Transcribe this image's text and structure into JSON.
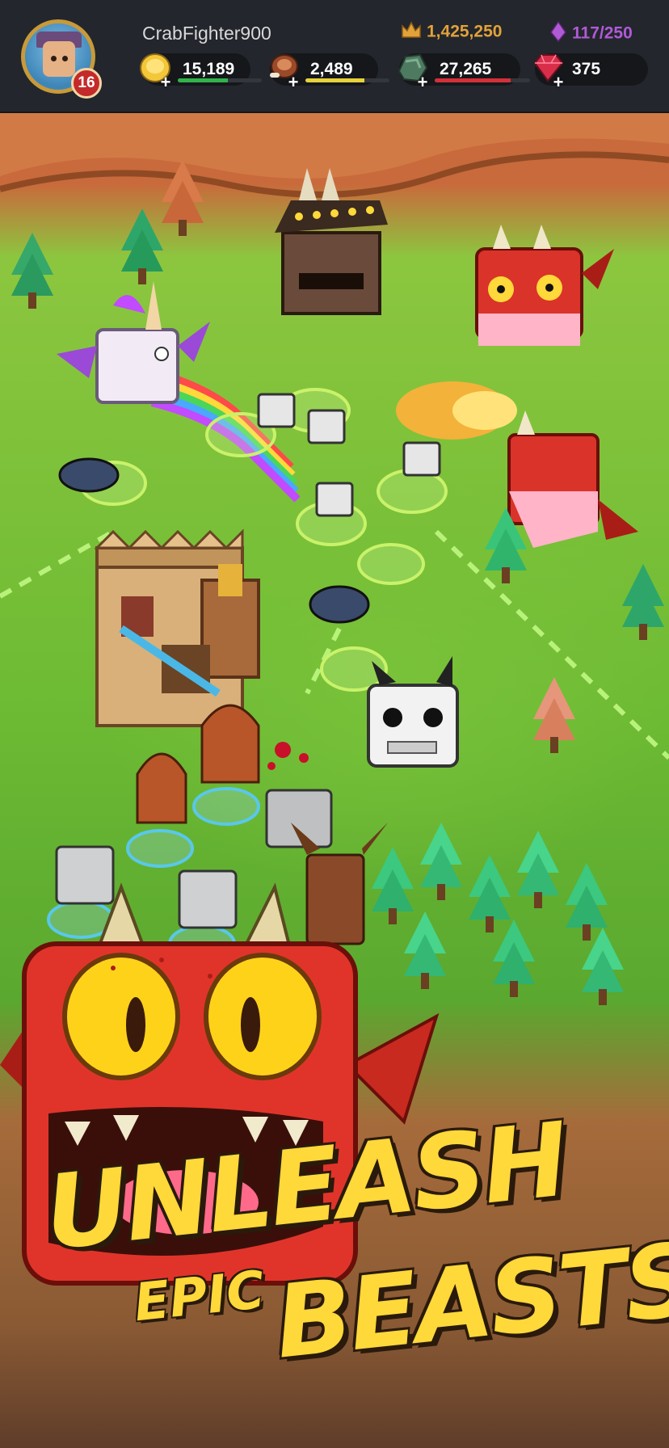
{
  "player": {
    "username": "CrabFighter900",
    "level": "16"
  },
  "hud": {
    "crowns": "1,425,250",
    "gems": "117/250",
    "resources": [
      {
        "name": "gold",
        "icon": "gold-coin-icon",
        "value": "15,189",
        "bar_color": "#2fb34a",
        "fill": 0.6
      },
      {
        "name": "meat",
        "icon": "meat-icon",
        "value": "2,489",
        "bar_color": "#e6d23a",
        "fill": 0.7
      },
      {
        "name": "stone",
        "icon": "stone-icon",
        "value": "27,265",
        "bar_color": "#d3303a",
        "fill": 0.8
      },
      {
        "name": "ruby",
        "icon": "ruby-icon",
        "value": "375"
      }
    ]
  },
  "promo": {
    "line1": "UNLEASH",
    "line2": "EPIC",
    "line3": "BEASTS!"
  },
  "colors": {
    "accent_gold": "#ffd83a",
    "crown": "#e2a23a",
    "gem_purple": "#b05ad6",
    "level_badge": "#c42a2a"
  }
}
